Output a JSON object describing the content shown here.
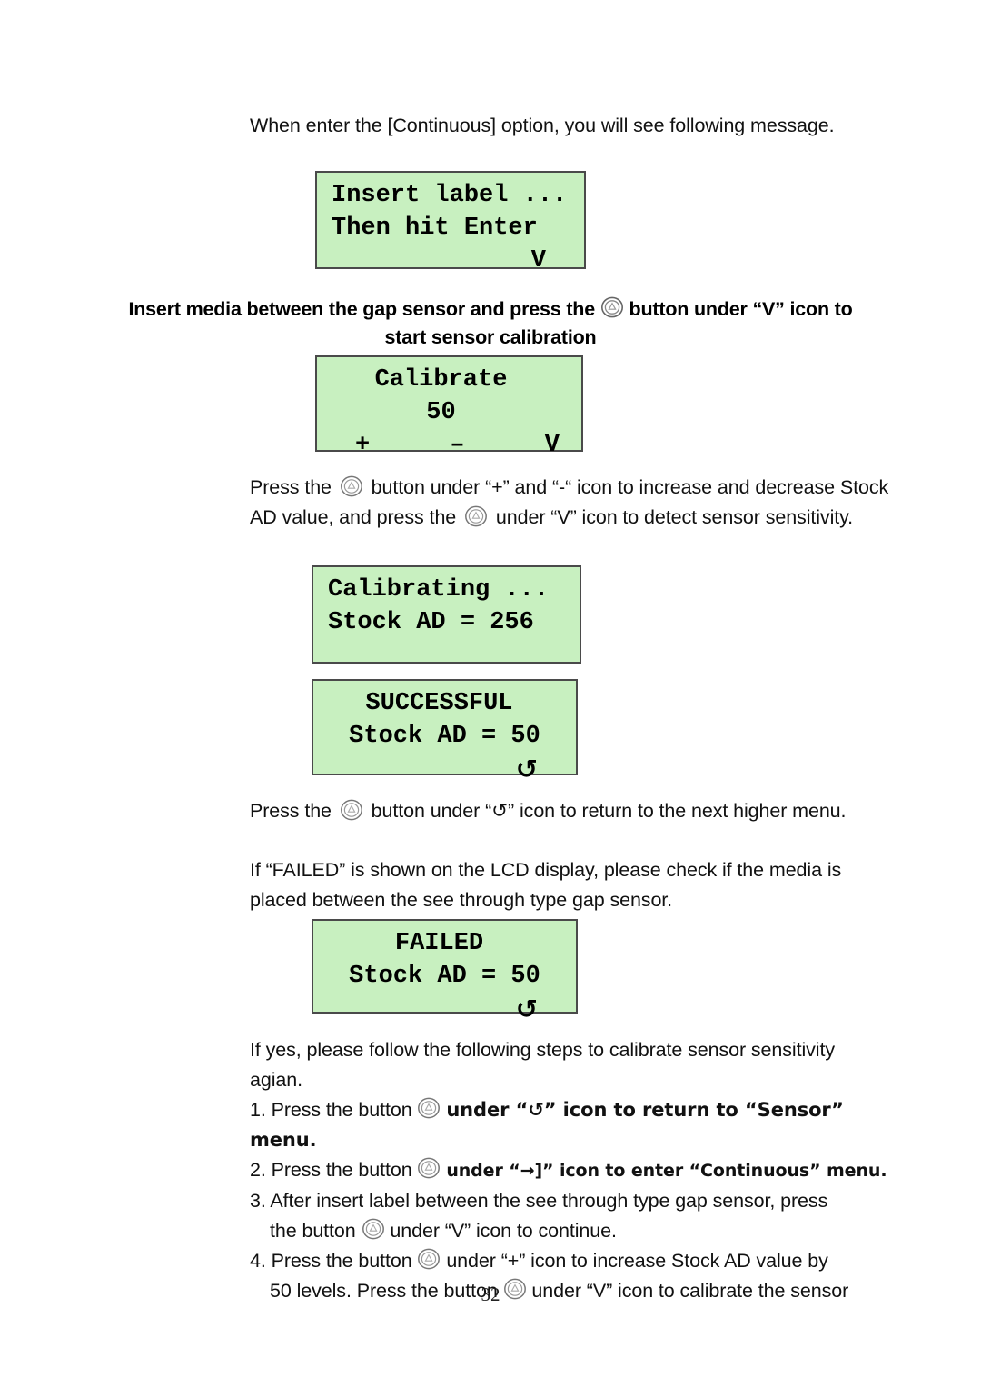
{
  "document": {
    "page_number": "32",
    "lcd_background_color": "#c8f0c0",
    "lcd_border_color": "#4a4a4a"
  },
  "intro": {
    "text": "When enter the [Continuous] option, you will see following message."
  },
  "lcd_insert_label": {
    "line1": "Insert label ...",
    "line2": "Then hit Enter",
    "line3": "V"
  },
  "bold_note": {
    "part1": "Insert media between the gap sensor and press the",
    "part2": "button under “V” icon to",
    "part3": "start sensor calibration"
  },
  "lcd_calibrate": {
    "title": "Calibrate",
    "value": "50",
    "key_plus": "+",
    "key_minus": "–",
    "key_enter": "V"
  },
  "para_press": {
    "seg1": "Press the",
    "seg2": "button under “+” and “-“ icon to increase and decrease",
    "seg3": "Stock AD value, and press the",
    "seg4": "under “V” icon to detect sensor",
    "seg5": "sensitivity."
  },
  "lcd_calibrating": {
    "line1": "Calibrating ...",
    "line2": "Stock AD = 256",
    "line3": ""
  },
  "lcd_successful": {
    "line1": "SUCCESSFUL",
    "line2": "Stock AD = 50",
    "line3": "↺"
  },
  "para_return": {
    "seg1": "Press the",
    "seg2": "button under “↺” icon to return to the next higher menu."
  },
  "para_failed": {
    "line1": "If “FAILED” is shown on the LCD display, please check if the media is",
    "line2": "placed between the see through type gap sensor."
  },
  "lcd_failed": {
    "line1": "FAILED",
    "line2": "Stock AD = 50",
    "line3": "↺"
  },
  "para_ifyes": {
    "line1": "If yes, please follow the following steps to calibrate sensor sensitivity",
    "line2": "agian."
  },
  "steps": {
    "step1": {
      "num": "1. Press the button",
      "tail": "under “↺” icon to return to “Sensor” menu."
    },
    "step2": {
      "num": "2. Press the button",
      "tail": "under “→]” icon to enter “Continuous” menu."
    },
    "step3": {
      "num": "3. After insert label between the see through type gap sensor, press",
      "cont_pre": "the button",
      "cont_tail": "under “V” icon to continue."
    },
    "step4": {
      "num": "4. Press the button",
      "tail": "under “+” icon to increase Stock AD value by",
      "cont_pre": "50 levels. Press the button",
      "cont_tail": "under “V” icon to calibrate the sensor"
    }
  },
  "icons": {
    "printer_button": "printer-round-button-icon",
    "loop_arrow": "↺",
    "feed_arrow": "→]"
  }
}
